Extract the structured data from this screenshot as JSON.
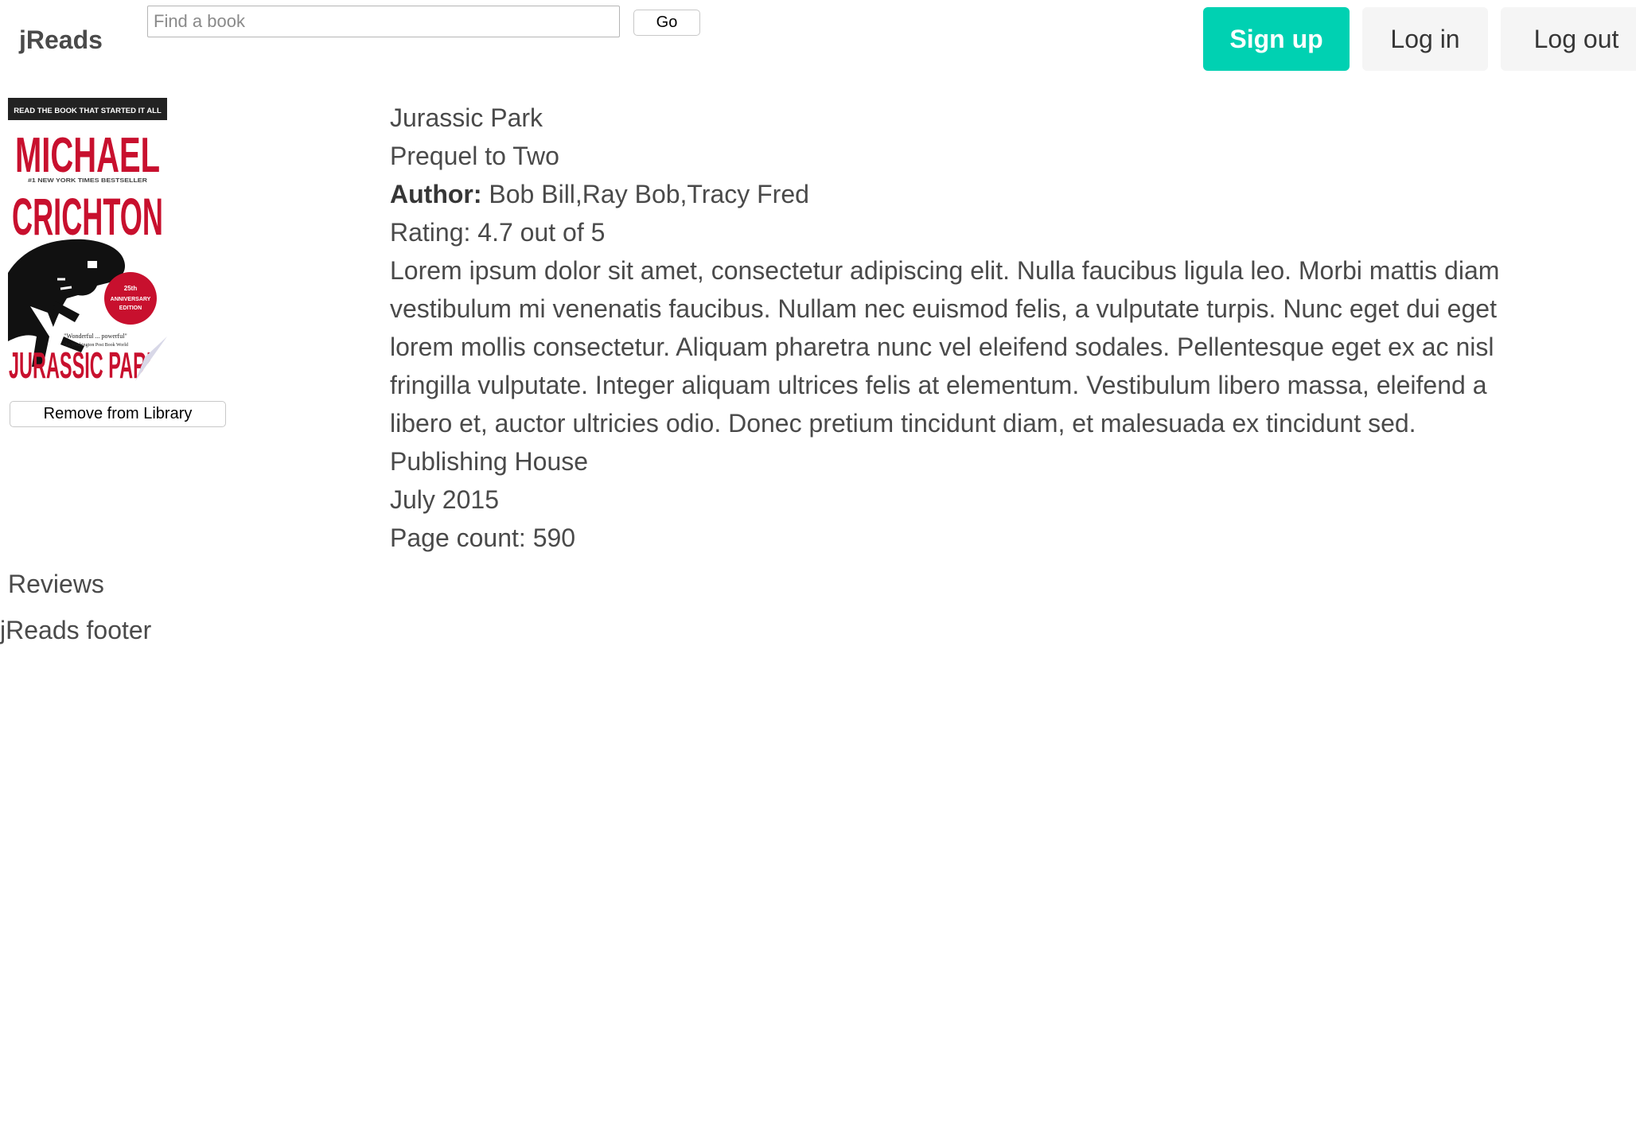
{
  "header": {
    "brand": "jReads",
    "search_placeholder": "Find a book",
    "search_value": "",
    "go_label": "Go",
    "signup_label": "Sign up",
    "login_label": "Log in",
    "logout_label": "Log out"
  },
  "cover": {
    "top_banner": "READ THE BOOK THAT STARTED IT ALL",
    "author_first": "MICHAEL",
    "author_last": "CRICHTON",
    "bestseller": "#1 NEW YORK TIMES BESTSELLER",
    "badge_line1": "25th",
    "badge_line2": "ANNIVERSARY",
    "badge_line3": "EDITION",
    "quote": "\"Wonderful ... powerful\"",
    "quote_source": "The Washington Post Book World",
    "title": "JURASSIC PARK"
  },
  "actions": {
    "remove_label": "Remove from Library"
  },
  "book": {
    "title": "Jurassic Park",
    "subtitle": "Prequel to Two",
    "author_label": "Author:",
    "authors": " Bob Bill,Ray Bob,Tracy Fred",
    "rating": "Rating: 4.7 out of 5",
    "description": "Lorem ipsum dolor sit amet, consectetur adipiscing elit. Nulla faucibus ligula leo. Morbi mattis diam vestibulum mi venenatis faucibus. Nullam nec euismod felis, a vulputate turpis. Nunc eget dui eget lorem mollis consectetur. Aliquam pharetra nunc vel eleifend sodales. Pellentesque eget ex ac nisl fringilla vulputate. Integer aliquam ultrices felis at elementum. Vestibulum libero massa, eleifend a libero et, auctor ultricies odio. Donec pretium tincidunt diam, et malesuada ex tincidunt sed.",
    "publisher": "Publishing House",
    "published": "July 2015",
    "page_count": "Page count: 590"
  },
  "reviews": {
    "heading": "Reviews"
  },
  "footer": {
    "text": "jReads footer"
  },
  "colors": {
    "primary": "#00d1b2",
    "light_button": "#f5f5f5",
    "text": "#4a4a4a",
    "cover_red": "#c8102e"
  }
}
